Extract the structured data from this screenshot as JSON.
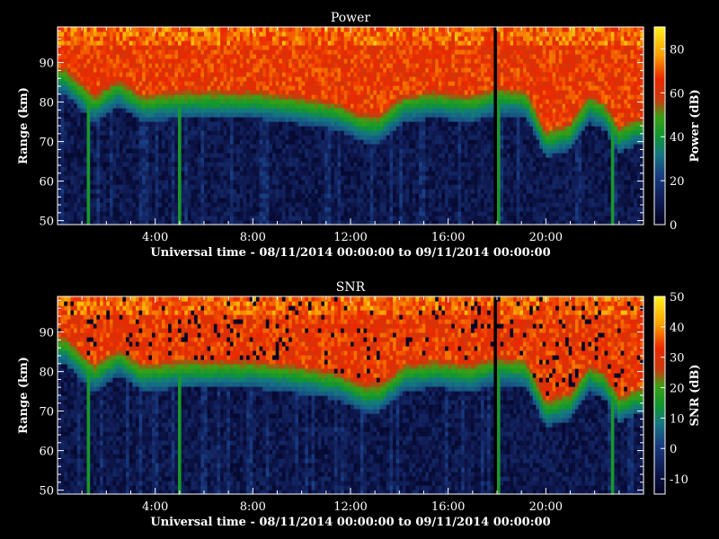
{
  "chart_data": [
    {
      "type": "heatmap",
      "title": "Power",
      "xlabel": "Universal time - 08/11/2014 00:00:00 to 09/11/2014 00:00:00",
      "ylabel": "Range (km)",
      "xlim": [
        0,
        24
      ],
      "ylim": [
        49,
        99
      ],
      "x_ticks": [
        "4:00",
        "8:00",
        "12:00",
        "16:00",
        "20:00"
      ],
      "x_tick_values": [
        4,
        8,
        12,
        16,
        20
      ],
      "y_ticks": [
        "50",
        "60",
        "70",
        "80",
        "90"
      ],
      "y_tick_values": [
        50,
        60,
        70,
        80,
        90
      ],
      "colorbar_label": "Power (dB)",
      "colorbar_range": [
        0,
        90
      ],
      "colorbar_ticks": [
        "0",
        "20",
        "40",
        "60",
        "80"
      ],
      "colorbar_tick_values": [
        0,
        20,
        40,
        60,
        80
      ],
      "boundary_profile_km": {
        "hours": [
          0.3,
          1.5,
          2.5,
          3.5,
          5.0,
          6.5,
          8.0,
          9.5,
          10.5,
          11.5,
          12.5,
          13.2,
          14.2,
          15.5,
          17.0,
          18.0,
          19.2,
          20.0,
          21.0,
          21.8,
          22.4,
          23.0,
          23.7
        ],
        "range": [
          85,
          78,
          82,
          78,
          79,
          79,
          79,
          78,
          77,
          76,
          73,
          73,
          78,
          79,
          78,
          80,
          79,
          69,
          71,
          78,
          76,
          70,
          72
        ]
      }
    },
    {
      "type": "heatmap",
      "title": "SNR",
      "xlabel": "Universal time - 08/11/2014 00:00:00 to 09/11/2014 00:00:00",
      "ylabel": "Range (km)",
      "xlim": [
        0,
        24
      ],
      "ylim": [
        49,
        99
      ],
      "x_ticks": [
        "4:00",
        "8:00",
        "12:00",
        "16:00",
        "20:00"
      ],
      "x_tick_values": [
        4,
        8,
        12,
        16,
        20
      ],
      "y_ticks": [
        "50",
        "60",
        "70",
        "80",
        "90"
      ],
      "y_tick_values": [
        50,
        60,
        70,
        80,
        90
      ],
      "colorbar_label": "SNR (dB)",
      "colorbar_range": [
        -15,
        50
      ],
      "colorbar_ticks": [
        "-10",
        "0",
        "10",
        "20",
        "30",
        "40",
        "50"
      ],
      "colorbar_tick_values": [
        -10,
        0,
        10,
        20,
        30,
        40,
        50
      ],
      "boundary_profile_km": {
        "hours": [
          0.3,
          1.5,
          2.5,
          3.5,
          5.0,
          6.5,
          8.0,
          9.5,
          10.5,
          11.5,
          12.5,
          13.2,
          14.2,
          15.5,
          17.0,
          18.0,
          19.2,
          20.0,
          21.0,
          21.8,
          22.4,
          23.0,
          23.7
        ],
        "range": [
          85,
          78,
          82,
          78,
          79,
          79,
          79,
          78,
          77,
          76,
          73,
          73,
          78,
          79,
          78,
          80,
          79,
          69,
          71,
          78,
          76,
          70,
          72
        ]
      }
    }
  ]
}
